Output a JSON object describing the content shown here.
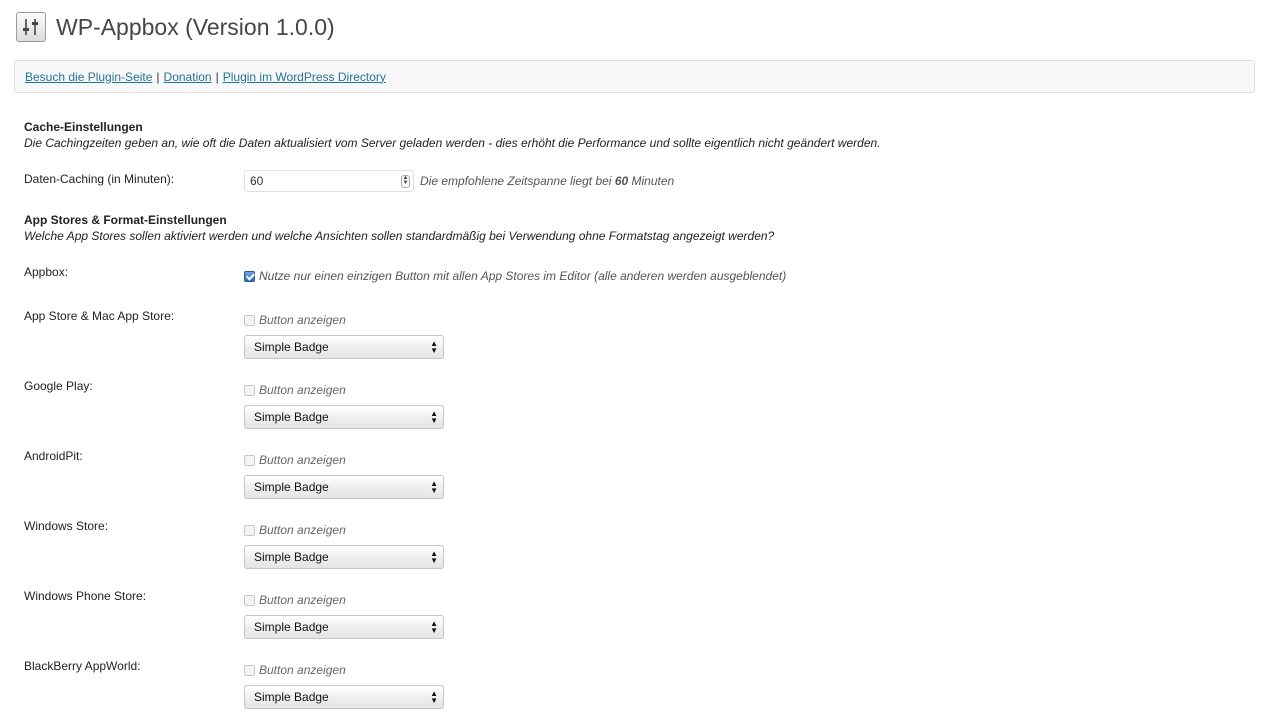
{
  "header": {
    "title": "WP-Appbox (Version 1.0.0)",
    "icon": "settings-sliders-icon"
  },
  "links": {
    "plugin_page": "Besuch die Plugin-Seite",
    "sep1": "|",
    "donation": "Donation",
    "sep2": "|",
    "directory": "Plugin im WordPress Directory",
    "link_color": "#21759b"
  },
  "cache": {
    "title": "Cache-Einstellungen",
    "description": "Die Cachingzeiten geben an, wie oft die Daten aktualisiert vom Server geladen werden - dies erhöht die Performance und sollte eigentlich nicht geändert werden.",
    "field_label": "Daten-Caching (in Minuten):",
    "field_value": "60",
    "hint_pre": "Die empfohlene Zeitspanne liegt bei",
    "hint_value": "60",
    "hint_post": "Minuten"
  },
  "stores": {
    "title": "App Stores & Format-Einstellungen",
    "description": "Welche App Stores sollen aktiviert werden und welche Ansichten sollen standardmäßig bei Verwendung ohne Formatstag angezeigt werden?",
    "appbox_label": "Appbox:",
    "appbox_checkbox_label": "Nutze nur einen einzigen Button mit allen App Stores im Editor (alle anderen werden ausgeblendet)",
    "appbox_checked": true,
    "items": [
      {
        "label": "App Store & Mac App Store:",
        "checkbox_label": "Button anzeigen",
        "checked": false,
        "select_value": "Simple Badge"
      },
      {
        "label": "Google Play:",
        "checkbox_label": "Button anzeigen",
        "checked": false,
        "select_value": "Simple Badge"
      },
      {
        "label": "AndroidPit:",
        "checkbox_label": "Button anzeigen",
        "checked": false,
        "select_value": "Simple Badge"
      },
      {
        "label": "Windows Store:",
        "checkbox_label": "Button anzeigen",
        "checked": false,
        "select_value": "Simple Badge"
      },
      {
        "label": "Windows Phone Store:",
        "checkbox_label": "Button anzeigen",
        "checked": false,
        "select_value": "Simple Badge"
      },
      {
        "label": "BlackBerry AppWorld:",
        "checkbox_label": "Button anzeigen",
        "checked": false,
        "select_value": "Simple Badge"
      }
    ]
  }
}
